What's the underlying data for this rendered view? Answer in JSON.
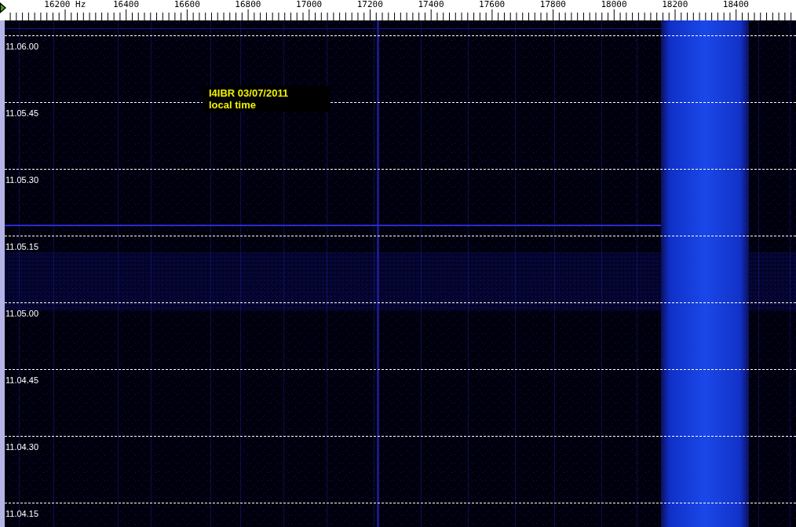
{
  "frequency_axis": {
    "labels": [
      "16200 Hz",
      "16400",
      "16600",
      "16800",
      "17000",
      "17200",
      "17400",
      "17600",
      "17800",
      "18000",
      "18200",
      "18400"
    ]
  },
  "time_axis": {
    "labels": [
      "11.06.00",
      "11.05.45",
      "11.05.30",
      "11.05.15",
      "11.05.00",
      "11.04.45",
      "11.04.30",
      "11.04.15"
    ]
  },
  "annotation": {
    "lines": [
      "I4IBR 03/07/2011",
      "local time"
    ]
  }
}
